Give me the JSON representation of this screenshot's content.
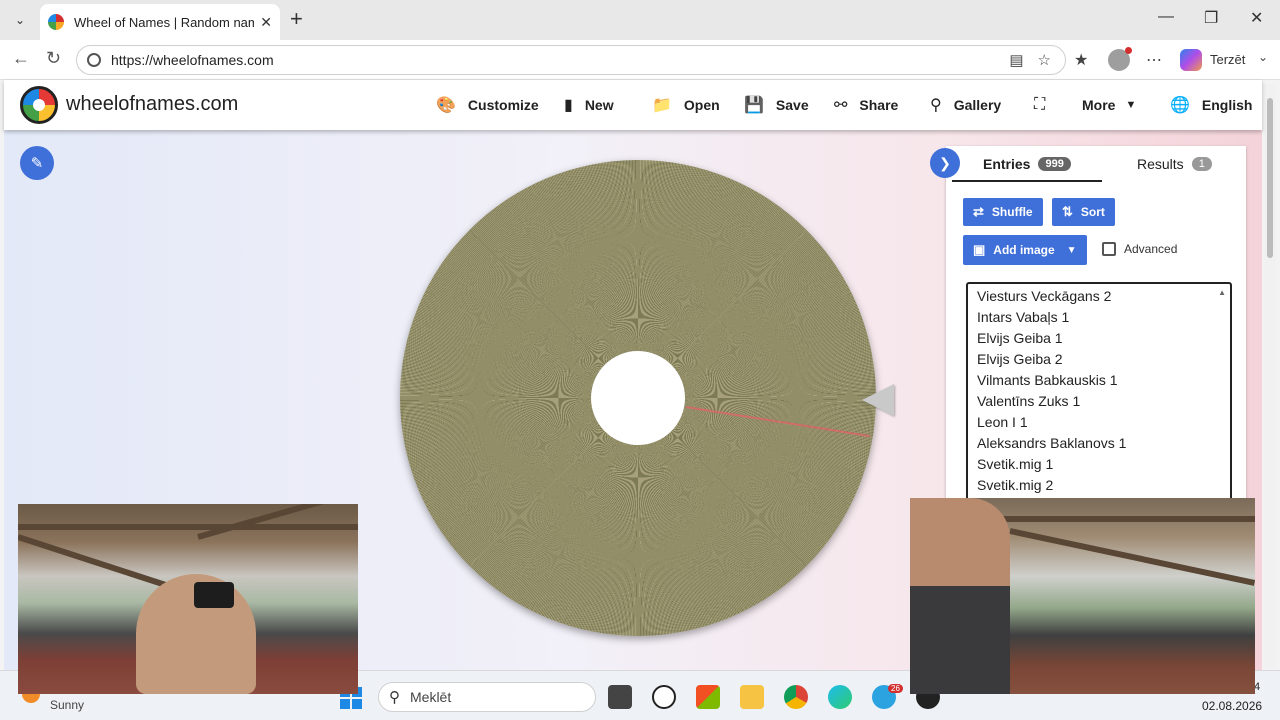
{
  "browser": {
    "tab_title": "Wheel of Names | Random name p",
    "url": "https://wheelofnames.com",
    "profile_label": "Terzēt"
  },
  "site": {
    "name": "wheelofnames.com",
    "nav": {
      "customize": "Customize",
      "new": "New",
      "open": "Open",
      "save": "Save",
      "share": "Share",
      "gallery": "Gallery",
      "more": "More",
      "language": "English"
    }
  },
  "panel": {
    "tabs": {
      "entries_label": "Entries",
      "entries_count": "999",
      "results_label": "Results",
      "results_count": "1"
    },
    "buttons": {
      "shuffle": "Shuffle",
      "sort": "Sort",
      "add_image": "Add image",
      "advanced": "Advanced"
    },
    "entries": [
      "Viesturs Veckāgans 2",
      "Intars Vabaļs 1",
      "Elvijs Geiba 1",
      "Elvijs Geiba 2",
      "Vilmants Babkauskis 1",
      "Valentīns Zuks 1",
      "Leon I 1",
      "Aleksandrs Baklanovs 1",
      "Svetik.mig 1",
      "Svetik.mig 2"
    ]
  },
  "taskbar": {
    "weather": "Sunny",
    "search_placeholder": "Meklēt",
    "telegram_badge": "26",
    "date": "02.08.2026",
    "time": "4"
  },
  "colors": {
    "accent": "#3f6fd8",
    "wheel_dark": "#7d7a56",
    "wheel_light": "#a6a17a"
  },
  "icons": {
    "edit": "pencil-icon",
    "toggle": "chevron-right-icon",
    "shuffle": "shuffle-icon",
    "sort": "sort-icon",
    "add_image": "image-icon"
  }
}
